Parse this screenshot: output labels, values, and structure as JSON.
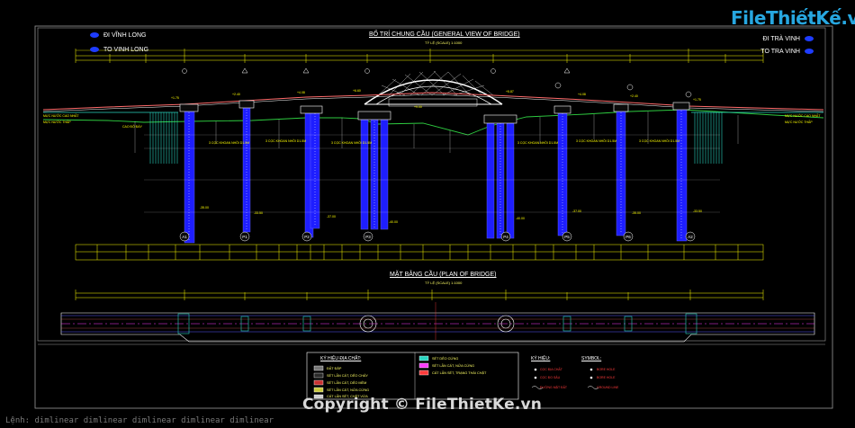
{
  "header": {
    "direction_left": [
      "ĐI VĨNH LONG",
      "TO VINH LONG"
    ],
    "direction_right": [
      "ĐI TRÀ VINH",
      "TO TRA VINH"
    ],
    "logo_text": "FileThiếtKế.vn"
  },
  "elevation": {
    "title": "BỐ TRÍ CHUNG CẦU (GENERAL VIEW OF BRIDGE)",
    "scale": "TỶ LỆ (SCALE) 1:1000",
    "pier_labels": [
      "A1",
      "P1",
      "P2",
      "P3",
      "P4",
      "P5",
      "P6",
      "A2"
    ]
  },
  "plan": {
    "title": "MẶT BẰNG CẦU (PLAN OF BRIDGE)",
    "scale": "TỶ LỆ (SCALE) 1:1000"
  },
  "geology_legend": {
    "title": "KÝ HIỆU ĐỊA CHẤT:"
  },
  "symbol_legend": {
    "title_vi": "KÝ HIỆU:",
    "title_en": "SYMBOL:"
  },
  "watermark": "Copyright © FileThietKe.vn",
  "command_line": "Lệnh:  dimlinear  dimlinear  dimlinear  dimlinear  dimlinear",
  "colors": {
    "background": "#000000",
    "pile": "#1e1eff",
    "ground": "#2ecc40",
    "arch": "#ffffff",
    "dimension": "#ffff00",
    "deck": "#ff5a5a",
    "abutment": "#2ad4c0"
  }
}
